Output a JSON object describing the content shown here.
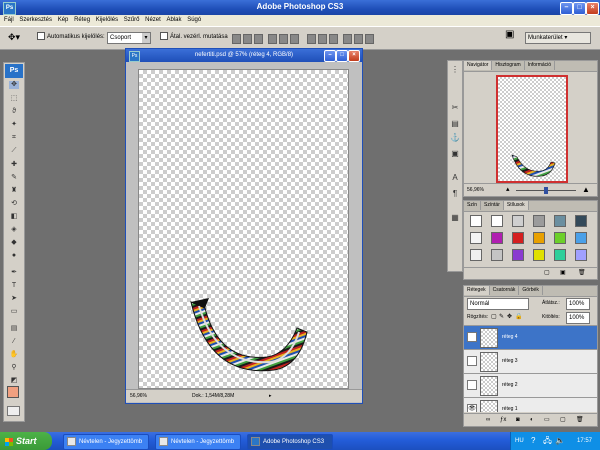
{
  "app": {
    "title": "Adobe Photoshop CS3",
    "icon_text": "Ps"
  },
  "menu": [
    "Fájl",
    "Szerkesztés",
    "Kép",
    "Réteg",
    "Kijelölés",
    "Szűrő",
    "Nézet",
    "Ablak",
    "Súgó"
  ],
  "options_bar": {
    "auto_select_label": "Automatikus kijelölés:",
    "auto_select_value": "Csoport",
    "transform_label": "Átal. vezérl. mutatása",
    "workspace_label": "Munkaterület ▾"
  },
  "document": {
    "title": "nefertiti.psd @ 57% (réteg 4, RGB/8)",
    "zoom": "56,96%",
    "doc_info": "Dok.: 1,54M/8,28M"
  },
  "navigator": {
    "tabs": [
      "Navigátor",
      "Hisztogram",
      "Információ"
    ],
    "zoom": "56,96%"
  },
  "styles_panel": {
    "tabs": [
      "Szín",
      "Színtár",
      "Stílusok"
    ],
    "swatch_colors": [
      "#ffffff",
      "#ffffff",
      "#cfcfcf",
      "#9b9b9b",
      "#6b8fa0",
      "#344a5a",
      "#f4f4f4",
      "#b01fb0",
      "#d41f1f",
      "#e8a000",
      "#6ccf2a",
      "#4aa0e8",
      "#f0f0f0",
      "#c4c4c4",
      "#8a3bd0",
      "#e0e000",
      "#2fcf9a",
      "#a0a0ff"
    ]
  },
  "layers_panel": {
    "tabs": [
      "Rétegek",
      "Csatornák",
      "Görbék"
    ],
    "blend_mode": "Normál",
    "opacity_label": "Átlátsz.:",
    "opacity_value": "100%",
    "lock_label": "Rögzítés:",
    "fill_label": "Kitöltés:",
    "fill_value": "100%",
    "layers": [
      {
        "name": "réteg 4",
        "active": true
      },
      {
        "name": "réteg 3",
        "active": false
      },
      {
        "name": "réteg 2",
        "active": false
      },
      {
        "name": "réteg 1",
        "active": false
      }
    ]
  },
  "taskbar": {
    "start": "Start",
    "tasks": [
      {
        "label": "Névtelen - Jegyzettömb",
        "active": false
      },
      {
        "label": "Névtelen - Jegyzettömb",
        "active": false
      },
      {
        "label": "Adobe Photoshop CS3",
        "active": true
      }
    ],
    "lang": "HU",
    "clock": "17:57"
  },
  "colors": {
    "xp_blue": "#245edb",
    "panel_gray": "#d4d0c8",
    "workspace_gray": "#6f6f6f",
    "foreground_swatch": "#f0a080"
  }
}
